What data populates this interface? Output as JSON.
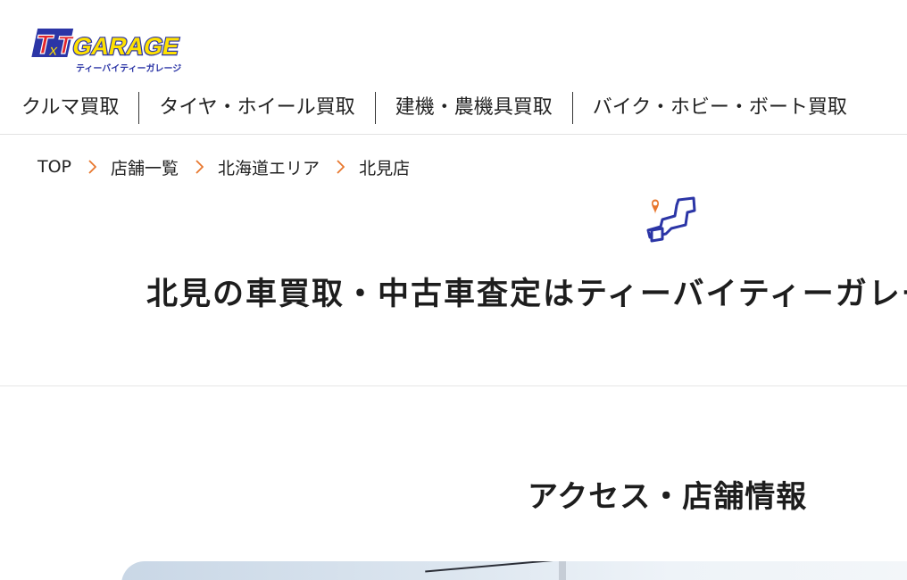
{
  "header": {
    "logo_text": "GARAGE",
    "logo_mark": "TxT",
    "logo_subtext": "ティーバイティーガレージ"
  },
  "global_nav": [
    {
      "label": "クルマ買取"
    },
    {
      "label": "タイヤ・ホイール買取"
    },
    {
      "label": "建機・農機具買取"
    },
    {
      "label": "バイク・ホビー・ボート買取"
    }
  ],
  "breadcrumb": [
    {
      "label": "TOP"
    },
    {
      "label": "店舗一覧"
    },
    {
      "label": "北海道エリア"
    },
    {
      "label": "北見店"
    }
  ],
  "hero": {
    "title": "北見の車買取・中古車査定はティーバイティーガレージ"
  },
  "access": {
    "heading": "アクセス・店舗情報"
  },
  "colors": {
    "chevron": "#e8772e",
    "map_pin": "#e8772e",
    "map_outline": "#2b35a6",
    "logo_red": "#e3262c",
    "logo_yellow": "#ffe100",
    "logo_blue": "#2b35a6"
  }
}
